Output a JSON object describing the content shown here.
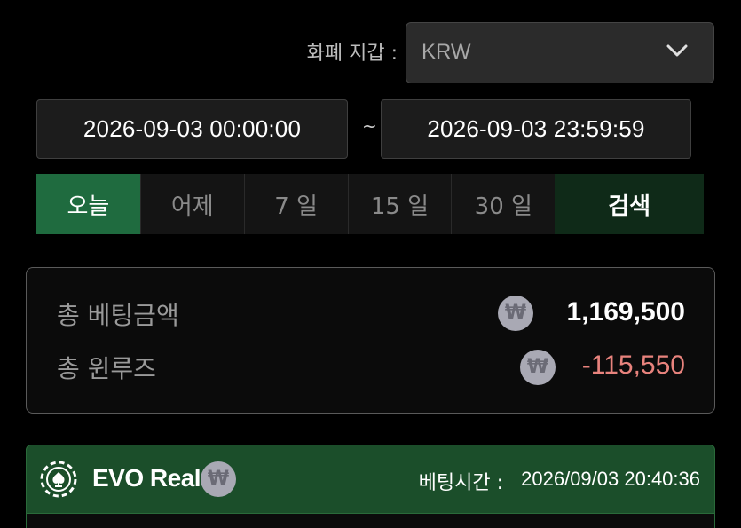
{
  "filter": {
    "currency_label": "화폐 지갑 :",
    "currency_value": "KRW",
    "date_start": "2026-09-03 00:00:00",
    "date_separator": "~",
    "date_end": "2026-09-03 23:59:59"
  },
  "period_tabs": [
    {
      "label": "오늘",
      "active": true
    },
    {
      "label": "어제",
      "active": false
    },
    {
      "label": "7 일",
      "active": false
    },
    {
      "label": "15 일",
      "active": false
    },
    {
      "label": "30 일",
      "active": false
    }
  ],
  "search_label": "검색",
  "summary": {
    "total_bet_label": "총 베팅금액",
    "total_bet_amount": "1,169,500",
    "total_winloss_label": "총 윈루즈",
    "total_winloss_amount": "-115,550",
    "currency_symbol": "₩"
  },
  "record": {
    "game_name": "EVO Real",
    "currency_symbol": "₩",
    "bet_time_label": "베팅시간 :",
    "bet_time_value": "2026/09/03 20:40:36"
  },
  "icons": {
    "dropdown": "chevron-down-icon",
    "chip": "casino-chip-icon",
    "currency": "won-icon"
  },
  "colors": {
    "active_tab": "#1f6b3f",
    "search_button": "#0f2a18",
    "record_header": "#1b4e2a",
    "negative_amount": "#e8837d"
  }
}
